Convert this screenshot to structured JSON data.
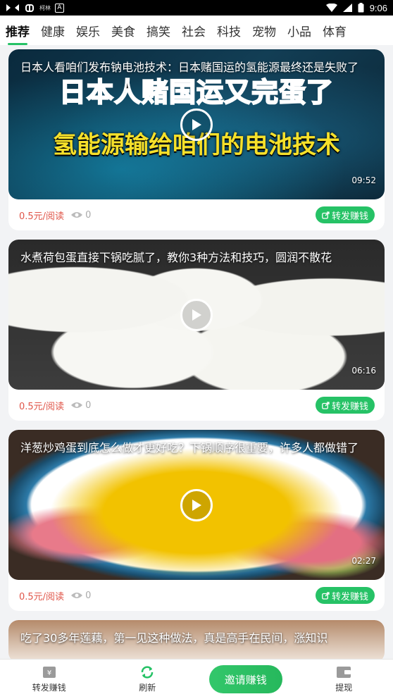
{
  "status_bar": {
    "left_small_text": "柯林",
    "time": "9:06",
    "battery_icon": "battery-icon",
    "wifi_icon": "wifi-icon",
    "signal_icon": "signal-icon"
  },
  "tabs": [
    {
      "label": "推荐",
      "active": true
    },
    {
      "label": "健康"
    },
    {
      "label": "娱乐"
    },
    {
      "label": "美食"
    },
    {
      "label": "搞笑"
    },
    {
      "label": "社会"
    },
    {
      "label": "科技"
    },
    {
      "label": "宠物"
    },
    {
      "label": "小品"
    },
    {
      "label": "体育"
    }
  ],
  "feed": [
    {
      "title": "日本人看咱们发布钠电池技术：日本赌国运的氢能源最终还是失败了",
      "overlay_line1": "日本人赌国运又完蛋了",
      "overlay_line2": "氢能源输给咱们的电池技术",
      "duration": "09:52",
      "price": "0.5元/阅读",
      "views": "0",
      "share_label": "转发赚钱"
    },
    {
      "title": "水煮荷包蛋直接下锅吃腻了，教你3种方法和技巧，圆润不散花",
      "duration": "06:16",
      "price": "0.5元/阅读",
      "views": "0",
      "share_label": "转发赚钱"
    },
    {
      "title": "洋葱炒鸡蛋到底怎么做才更好吃？下锅顺序很重要，许多人都做错了",
      "duration": "02:27",
      "price": "0.5元/阅读",
      "views": "0",
      "share_label": "转发赚钱"
    },
    {
      "title": "吃了30多年莲藕，第一见这种做法，真是高手在民间，涨知识"
    }
  ],
  "bottom_nav": {
    "share_earn": "转发赚钱",
    "refresh": "刷新",
    "invite": "邀请赚钱",
    "withdraw": "提现"
  },
  "colors": {
    "accent": "#26c266",
    "price": "#e0564a"
  }
}
